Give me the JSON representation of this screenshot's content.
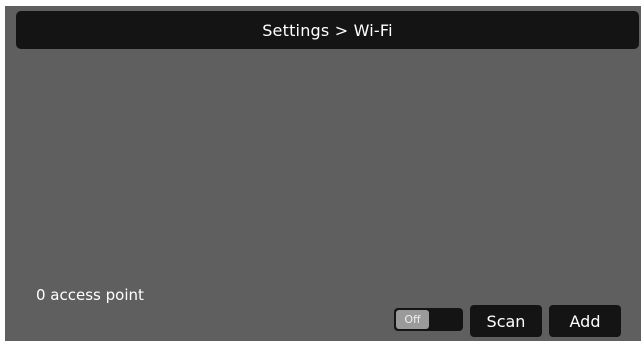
{
  "header": {
    "title": "Settings > Wi-Fi"
  },
  "status": {
    "access_point_count": "0 access point"
  },
  "wifi_toggle": {
    "state_label": "Off",
    "enabled": false
  },
  "buttons": {
    "scan_label": "Scan",
    "add_label": "Add"
  },
  "colors": {
    "background": "#5f5f5f",
    "bar": "#141414",
    "text": "#ffffff",
    "toggle_knob": "#9a9a9a"
  }
}
